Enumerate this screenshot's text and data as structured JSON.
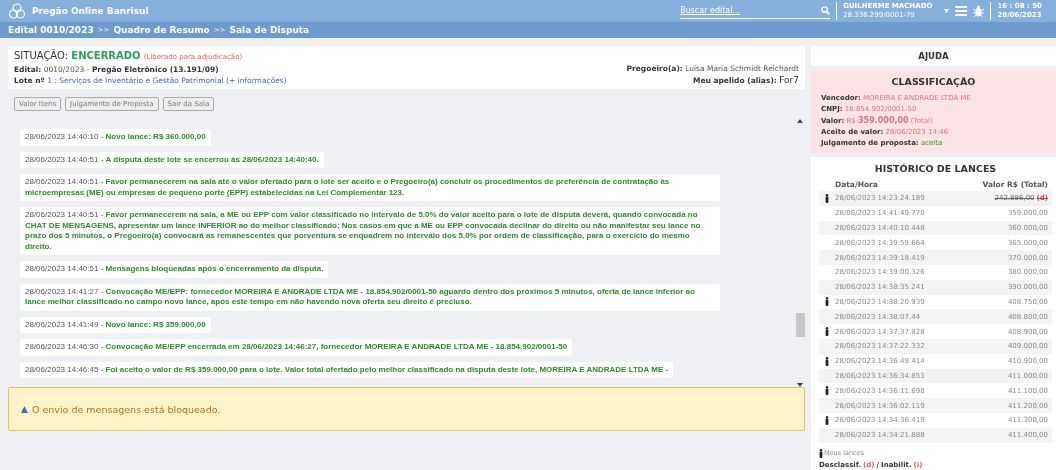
{
  "header": {
    "app_name": "Pregão Online Banrisul",
    "search": {
      "placeholder": "Buscar edital..."
    },
    "user": {
      "name": "GUILHERME MACHADO",
      "cnpj": "28.336.299/0001-79"
    },
    "clock": {
      "time": "16 : 08 : 50",
      "date": "28/06/2023"
    }
  },
  "breadcrumb": [
    "Edital 0010/2023",
    "Quadro de Resumo",
    "Sala de Disputa"
  ],
  "breadcrumb_separator": ">>",
  "message_separator": "-",
  "status": {
    "label": "SITUAÇÃO:",
    "value": "ENCERRADO",
    "note": "(Liberado para adjudicação)"
  },
  "edital": {
    "label": "Edital:",
    "number": "0010/2023",
    "separator": "-",
    "type": "Pregão Eletrônico (13.191/09)"
  },
  "lote": {
    "label": "Lote nº",
    "number": "1 :",
    "description": "Serviços de Inventário e Gestão Patrimonial",
    "more": "(+ informações)"
  },
  "pregoeiro": {
    "label": "Pregoeiro(a):",
    "name": "Luisa Maria Schmidt Reichardt"
  },
  "alias": {
    "label": "Meu apelido (alias):",
    "value": "For7"
  },
  "buttons": [
    "Valor Itens",
    "Julgamento de Proposta",
    "Sair da Sala"
  ],
  "messages": [
    {
      "time": "28/06/2023 14:40:10",
      "text": "Novo lance: R$ 360.000,00"
    },
    {
      "time": "28/06/2023 14:40:51",
      "text": "A disputa deste lote se encerrou às 28/06/2023 14:40:40."
    },
    {
      "time": "28/06/2023 14:40:51",
      "text": "Favor permanecerem na sala até o valor ofertado para o lote ser aceito e o Pregoeiro(a) concluir os procedimentos de preferência de contratação às microempresas (ME) ou empresas de pequeno porte (EPP) estabelecidas na Lei Complementar 123."
    },
    {
      "time": "28/06/2023 14:40:51",
      "text": "Favor permanecerem na sala, a ME ou EPP com valor classificado no intervalo de 5.0% do valor aceito para o lote de disputa deverá, quando convocada no CHAT DE MENSAGENS, apresentar um lance INFERIOR ao do melhor classificado; Nos casos em que a ME ou EPP convocada declinar do direito ou não manifestar seu lance no prazo dos 5 minutos, o Pregoeiro(a) convocará as remanescentes que porventura se enquadrem no intervalo dos 5.0% por ordem de classificação, para o exercício do mesmo direito."
    },
    {
      "time": "28/06/2023 14:40:51",
      "text": "Mensagens bloqueadas após o encerramento da disputa."
    },
    {
      "time": "28/06/2023 14:41:27",
      "text": "Convocação ME/EPP: fornecedor MOREIRA E ANDRADE LTDA ME - 18.854.902/0001-50 aguardo dentro dos próximos 5 minutos, oferta de lance inferior ao lance melhor classificado no campo novo lance, após este tempo em não havendo nova oferta seu direito é precluso."
    },
    {
      "time": "28/06/2023 14:41:49",
      "text": "Novo lance: R$ 359.000,00"
    },
    {
      "time": "28/06/2023 14:46:30",
      "text": "Convocação ME/EPP encerrada em 28/06/2023 14:46:27, fornecedor MOREIRA E ANDRADE LTDA ME - 18.854.902/0001-50"
    },
    {
      "time": "28/06/2023 14:46:45",
      "text": "Foi aceito o valor de R$ 359.000,00 para o lote. Valor total ofertado pelo melhor classificado na disputa deste lote, MOREIRA E ANDRADE LTDA ME -"
    }
  ],
  "alert": "O envio de mensagens está bloqueado.",
  "help_title": "AJUDA",
  "classification": {
    "title": "CLASSIFICAÇÃO",
    "winner_label": "Vencedor:",
    "winner": "MOREIRA E ANDRADE LTDA ME",
    "cnpj_label": "CNPJ:",
    "cnpj": "18.854.902/0001-50",
    "value_label": "Valor:",
    "currency": "R$",
    "value": "359.000,00",
    "value_note": "(Total)",
    "accept_label": "Aceite de valor:",
    "accept": "28/06/2023 14:46",
    "judgement_label": "Julgamento de proposta:",
    "judgement": "aceita"
  },
  "history": {
    "title": "HISTÓRICO DE LANCES",
    "columns": [
      "Data/Hora",
      "Valor R$ (Total)"
    ],
    "rows": [
      {
        "time": "28/06/2023 14:23:24.189",
        "value": "242.886,00",
        "flag": "(d)",
        "mine": true,
        "disqualified": true
      },
      {
        "time": "28/06/2023 14:41:49.770",
        "value": "359.000,00",
        "mine": false,
        "disqualified": false
      },
      {
        "time": "28/06/2023 14:40:10.448",
        "value": "360.000,00",
        "mine": false,
        "disqualified": false
      },
      {
        "time": "28/06/2023 14:39:59.664",
        "value": "365.000,00",
        "mine": false,
        "disqualified": false
      },
      {
        "time": "28/06/2023 14:39:18.419",
        "value": "370.000,00",
        "mine": false,
        "disqualified": false
      },
      {
        "time": "28/06/2023 14:39:00.326",
        "value": "380.000,00",
        "mine": false,
        "disqualified": false
      },
      {
        "time": "28/06/2023 14:38:35.241",
        "value": "390.000,00",
        "mine": false,
        "disqualified": false
      },
      {
        "time": "28/06/2023 14:38:20.939",
        "value": "408.750,00",
        "mine": true,
        "disqualified": false
      },
      {
        "time": "28/06/2023 14:38:07.44",
        "value": "408.800,00",
        "mine": false,
        "disqualified": false
      },
      {
        "time": "28/06/2023 14:37:37.828",
        "value": "408.900,00",
        "mine": true,
        "disqualified": false
      },
      {
        "time": "28/06/2023 14:37:22.332",
        "value": "409.000,00",
        "mine": false,
        "disqualified": false
      },
      {
        "time": "28/06/2023 14:36:49.414",
        "value": "410.900,00",
        "mine": true,
        "disqualified": false
      },
      {
        "time": "28/06/2023 14:36:34.853",
        "value": "411.000,00",
        "mine": false,
        "disqualified": false
      },
      {
        "time": "28/06/2023 14:36:11.698",
        "value": "411.100,00",
        "mine": true,
        "disqualified": false
      },
      {
        "time": "28/06/2023 14:36:02.119",
        "value": "411.200,00",
        "mine": false,
        "disqualified": false
      },
      {
        "time": "28/06/2023 14:34:36.419",
        "value": "411.300,00",
        "mine": true,
        "disqualified": false
      },
      {
        "time": "28/06/2023 14:34:21.888",
        "value": "411.400,00",
        "mine": false,
        "disqualified": false
      }
    ],
    "legend_mine": "Meus lances",
    "legend_disq": "Desclassif.",
    "legend_d": "(d)",
    "legend_sep": "/",
    "legend_inab": "Inabilit.",
    "legend_i": "(i)"
  }
}
